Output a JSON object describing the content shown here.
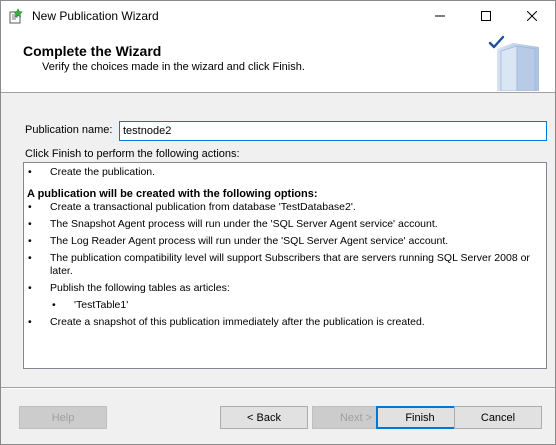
{
  "window": {
    "title": "New Publication Wizard"
  },
  "header": {
    "title": "Complete the Wizard",
    "subtitle": "Verify the choices made in the wizard and click Finish."
  },
  "form": {
    "publication_name_label": "Publication name:",
    "publication_name_value": "testnode2",
    "actions_label": "Click Finish to perform the following actions:"
  },
  "actions": {
    "first": "Create the publication.",
    "heading": "A publication will be created with the following options:",
    "items": [
      "Create a transactional publication from database 'TestDatabase2'.",
      "The Snapshot Agent process will run under the 'SQL Server Agent service' account.",
      "The Log Reader Agent process will run under the 'SQL Server Agent service' account.",
      "The publication compatibility level will support Subscribers that are servers running SQL Server 2008 or later.",
      "Publish the following tables as articles:"
    ],
    "article": "'TestTable1'",
    "last": "Create a snapshot of this publication immediately after the publication is created.",
    "bullet": "•"
  },
  "buttons": {
    "help": "Help",
    "back": "< Back",
    "next": "Next >",
    "finish": "Finish",
    "cancel": "Cancel"
  },
  "icons": {
    "app": "wizard-icon",
    "minimize": "minimize-icon",
    "maximize": "maximize-icon",
    "close": "close-icon",
    "header_art": "books-checkmark-icon"
  },
  "colors": {
    "accent": "#0078d7",
    "window_bg": "#f0f0f0"
  }
}
